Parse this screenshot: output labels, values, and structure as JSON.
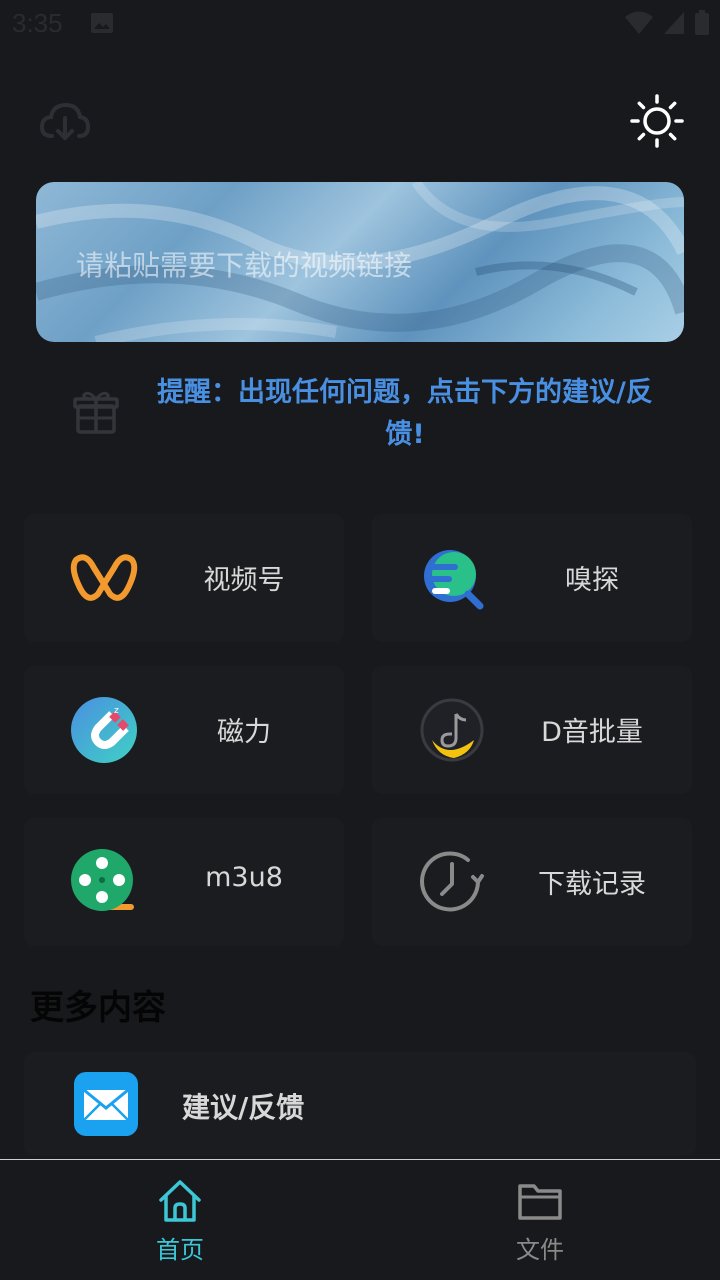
{
  "status_bar": {
    "time": "3:35"
  },
  "header": {
    "left_icon": "cloud-download-icon",
    "right_icon": "sun-icon"
  },
  "link_input": {
    "placeholder": "请粘贴需要下载的视频链接",
    "value": ""
  },
  "reminder": {
    "icon": "gift-icon",
    "text": "提醒：出现任何问题，点击下方的建议/反馈!"
  },
  "features": [
    {
      "label": "视频号",
      "icon": "channels-icon"
    },
    {
      "label": "嗅探",
      "icon": "sniff-search-icon"
    },
    {
      "label": "磁力",
      "icon": "magnet-icon"
    },
    {
      "label": "D音批量",
      "icon": "douyin-batch-icon"
    },
    {
      "label": "m3u8",
      "icon": "film-reel-icon"
    },
    {
      "label": "下载记录",
      "icon": "history-clock-icon"
    }
  ],
  "more_section": {
    "title": "更多内容",
    "items": [
      {
        "label": "建议/反馈",
        "icon": "mail-icon"
      }
    ]
  },
  "bottom_nav": {
    "items": [
      {
        "label": "首页",
        "icon": "home-icon",
        "active": true
      },
      {
        "label": "文件",
        "icon": "folder-icon",
        "active": false
      }
    ]
  },
  "colors": {
    "background": "#18191d",
    "accent_active": "#3dc7d6",
    "reminder_blue": "#4a90e2",
    "inactive": "#8a8a8a"
  }
}
